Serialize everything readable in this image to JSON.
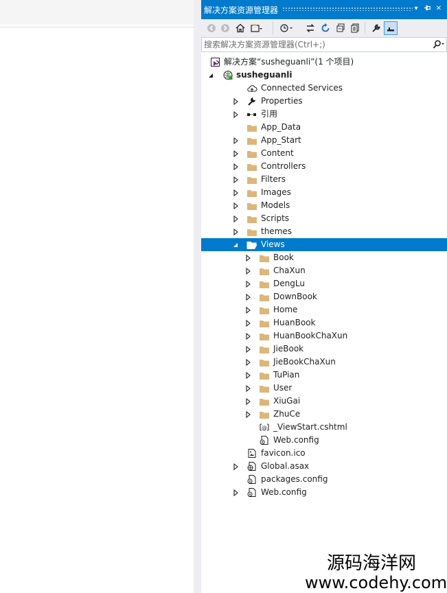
{
  "panel": {
    "title": "解决方案资源管理器",
    "title_buttons": [
      "▾",
      "‑ᵖ",
      "✕"
    ]
  },
  "toolbar": {
    "tools": [
      "back-icon",
      "forward-icon",
      "home-icon",
      "switch-views-icon",
      "pending-changes-icon",
      "sync-icon",
      "refresh-icon",
      "collapse-all-icon",
      "show-all-files-icon",
      "properties-icon",
      "preview-icon"
    ]
  },
  "search": {
    "placeholder": "搜索解决方案资源管理器(Ctrl+;)",
    "value": ""
  },
  "tree": [
    {
      "label": "解决方案“susheguanli”(1 个项目)",
      "icon": "solution",
      "level": 0,
      "expander": "none"
    },
    {
      "label": "susheguanli",
      "icon": "web-project",
      "level": 0,
      "expander": "expanded",
      "bold": true
    },
    {
      "label": "Connected Services",
      "icon": "cloud",
      "level": 1,
      "expander": "none"
    },
    {
      "label": "Properties",
      "icon": "wrench",
      "level": 1,
      "expander": "collapsed"
    },
    {
      "label": "引用",
      "icon": "references",
      "level": 1,
      "expander": "collapsed"
    },
    {
      "label": "App_Data",
      "icon": "folder",
      "level": 1,
      "expander": "none"
    },
    {
      "label": "App_Start",
      "icon": "folder",
      "level": 1,
      "expander": "collapsed"
    },
    {
      "label": "Content",
      "icon": "folder",
      "level": 1,
      "expander": "collapsed"
    },
    {
      "label": "Controllers",
      "icon": "folder",
      "level": 1,
      "expander": "collapsed"
    },
    {
      "label": "Filters",
      "icon": "folder",
      "level": 1,
      "expander": "collapsed"
    },
    {
      "label": "Images",
      "icon": "folder",
      "level": 1,
      "expander": "collapsed"
    },
    {
      "label": "Models",
      "icon": "folder",
      "level": 1,
      "expander": "collapsed"
    },
    {
      "label": "Scripts",
      "icon": "folder",
      "level": 1,
      "expander": "collapsed"
    },
    {
      "label": "themes",
      "icon": "folder",
      "level": 1,
      "expander": "collapsed"
    },
    {
      "label": "Views",
      "icon": "folder-open",
      "level": 1,
      "expander": "expanded",
      "selected": true
    },
    {
      "label": "Book",
      "icon": "folder",
      "level": 2,
      "expander": "collapsed"
    },
    {
      "label": "ChaXun",
      "icon": "folder",
      "level": 2,
      "expander": "collapsed"
    },
    {
      "label": "DengLu",
      "icon": "folder",
      "level": 2,
      "expander": "collapsed"
    },
    {
      "label": "DownBook",
      "icon": "folder",
      "level": 2,
      "expander": "collapsed"
    },
    {
      "label": "Home",
      "icon": "folder",
      "level": 2,
      "expander": "collapsed"
    },
    {
      "label": "HuanBook",
      "icon": "folder",
      "level": 2,
      "expander": "collapsed"
    },
    {
      "label": "HuanBookChaXun",
      "icon": "folder",
      "level": 2,
      "expander": "collapsed"
    },
    {
      "label": "JieBook",
      "icon": "folder",
      "level": 2,
      "expander": "collapsed"
    },
    {
      "label": "JieBookChaXun",
      "icon": "folder",
      "level": 2,
      "expander": "collapsed"
    },
    {
      "label": "TuPian",
      "icon": "folder",
      "level": 2,
      "expander": "collapsed"
    },
    {
      "label": "User",
      "icon": "folder",
      "level": 2,
      "expander": "collapsed"
    },
    {
      "label": "XiuGai",
      "icon": "folder",
      "level": 2,
      "expander": "collapsed"
    },
    {
      "label": "ZhuCe",
      "icon": "folder",
      "level": 2,
      "expander": "collapsed"
    },
    {
      "label": "_ViewStart.cshtml",
      "icon": "razor-file",
      "level": 2,
      "expander": "none"
    },
    {
      "label": "Web.config",
      "icon": "config-file",
      "level": 2,
      "expander": "none"
    },
    {
      "label": "favicon.ico",
      "icon": "ico-file",
      "level": 1,
      "expander": "none"
    },
    {
      "label": "Global.asax",
      "icon": "asax-file",
      "level": 1,
      "expander": "collapsed"
    },
    {
      "label": "packages.config",
      "icon": "config-file",
      "level": 1,
      "expander": "none"
    },
    {
      "label": "Web.config",
      "icon": "config-file",
      "level": 1,
      "expander": "collapsed"
    }
  ],
  "watermark": {
    "line1": "源码海洋网",
    "line2": "www.codehy.com"
  },
  "colors": {
    "accent": "#007acc",
    "folder": "#dcb67a",
    "toolbar_bg": "#eeeef2",
    "selection_text": "#ffffff"
  }
}
